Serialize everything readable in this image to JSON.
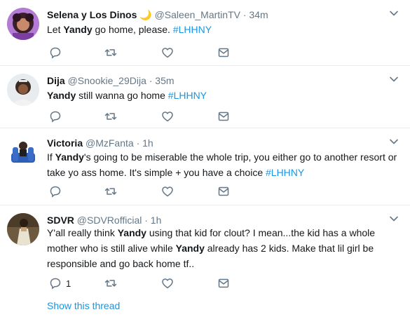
{
  "colors": {
    "link": "#1b95e0",
    "muted": "#657786",
    "text": "#14171a",
    "divider": "#e6ecf0"
  },
  "tweets": [
    {
      "name": "Selena y Los Dinos",
      "emoji": "🌙",
      "handle": "@Saleen_MartinTV",
      "time": "· 34m",
      "parts": [
        "Let ",
        "Yandy",
        " go home, please. ",
        "#LHHNY"
      ],
      "reply_count": ""
    },
    {
      "name": "Dija",
      "handle": "@Snookie_29Dija",
      "time": "· 35m",
      "parts": [
        "Yandy",
        " still wanna go home ",
        "#LHHNY"
      ],
      "reply_count": ""
    },
    {
      "name": "Victoria",
      "handle": "@MzFanta",
      "time": "· 1h",
      "line1_parts": [
        "If ",
        "Yandy",
        "'s going to be miserable the whole trip, you either go to another resort or"
      ],
      "line2_parts": [
        "take yo ass home. It's simple + you have a choice ",
        "#LHHNY"
      ],
      "reply_count": ""
    },
    {
      "name": "SDVR",
      "handle": "@SDVRofficial",
      "time": "· 1h",
      "line1_parts": [
        "Y'all really think ",
        "Yandy",
        " using that kid for clout? I mean...the kid has a whole"
      ],
      "line2_parts": [
        "mother who is still alive while ",
        "Yandy",
        " already has 2 kids. Make that lil girl be"
      ],
      "line3": "responsible and go back home tf..",
      "reply_count": "1"
    }
  ],
  "show_thread": "Show this thread",
  "icons": [
    "reply-icon",
    "retweet-icon",
    "like-icon",
    "dm-icon",
    "caret-down-icon"
  ]
}
